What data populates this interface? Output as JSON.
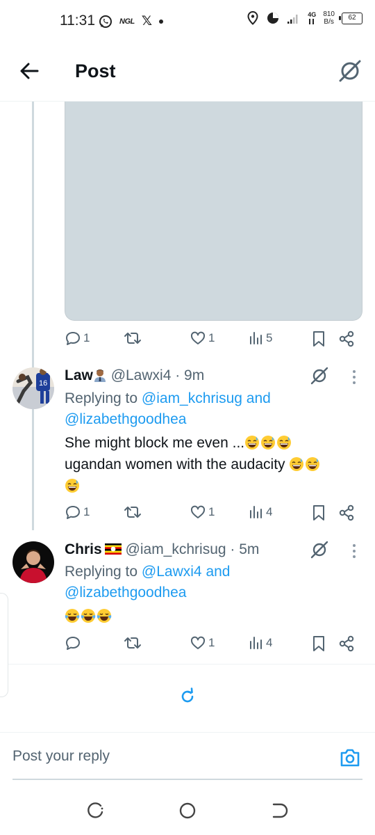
{
  "status_bar": {
    "time": "11:31",
    "notif_ngl": "NGL",
    "notif_x": "𝕏",
    "network_type": "4G",
    "net_speed_value": "810",
    "net_speed_unit": "B/s",
    "battery": "62"
  },
  "header": {
    "title": "Post"
  },
  "tweet_top": {
    "actions": {
      "replies": "1",
      "reposts": "",
      "likes": "1",
      "views": "5"
    }
  },
  "tweet_law": {
    "name": "Law",
    "handle": "@Lawxi4",
    "time": "· 9m",
    "replying_prefix": "Replying to",
    "mention_1": "@iam_kchrisug",
    "and": "and",
    "mention_2": "@lizabethgoodhea",
    "text_line1": "She might block me even ...",
    "text_line2": "ugandan women with the audacity ",
    "actions": {
      "replies": "1",
      "likes": "1",
      "views": "4"
    }
  },
  "tweet_chris": {
    "name": "Chris",
    "handle": "@iam_kchrisug",
    "time": "· 5m",
    "replying_prefix": "Replying to",
    "mention_1": "@Lawxi4",
    "and": "and",
    "mention_2": "@lizabethgoodhea",
    "actions": {
      "replies": "",
      "likes": "1",
      "views": "4"
    }
  },
  "composer": {
    "placeholder": "Post your reply"
  },
  "colors": {
    "link": "#1d9bf0",
    "secondary_text": "#536471",
    "thread_line": "#cfd9de"
  }
}
